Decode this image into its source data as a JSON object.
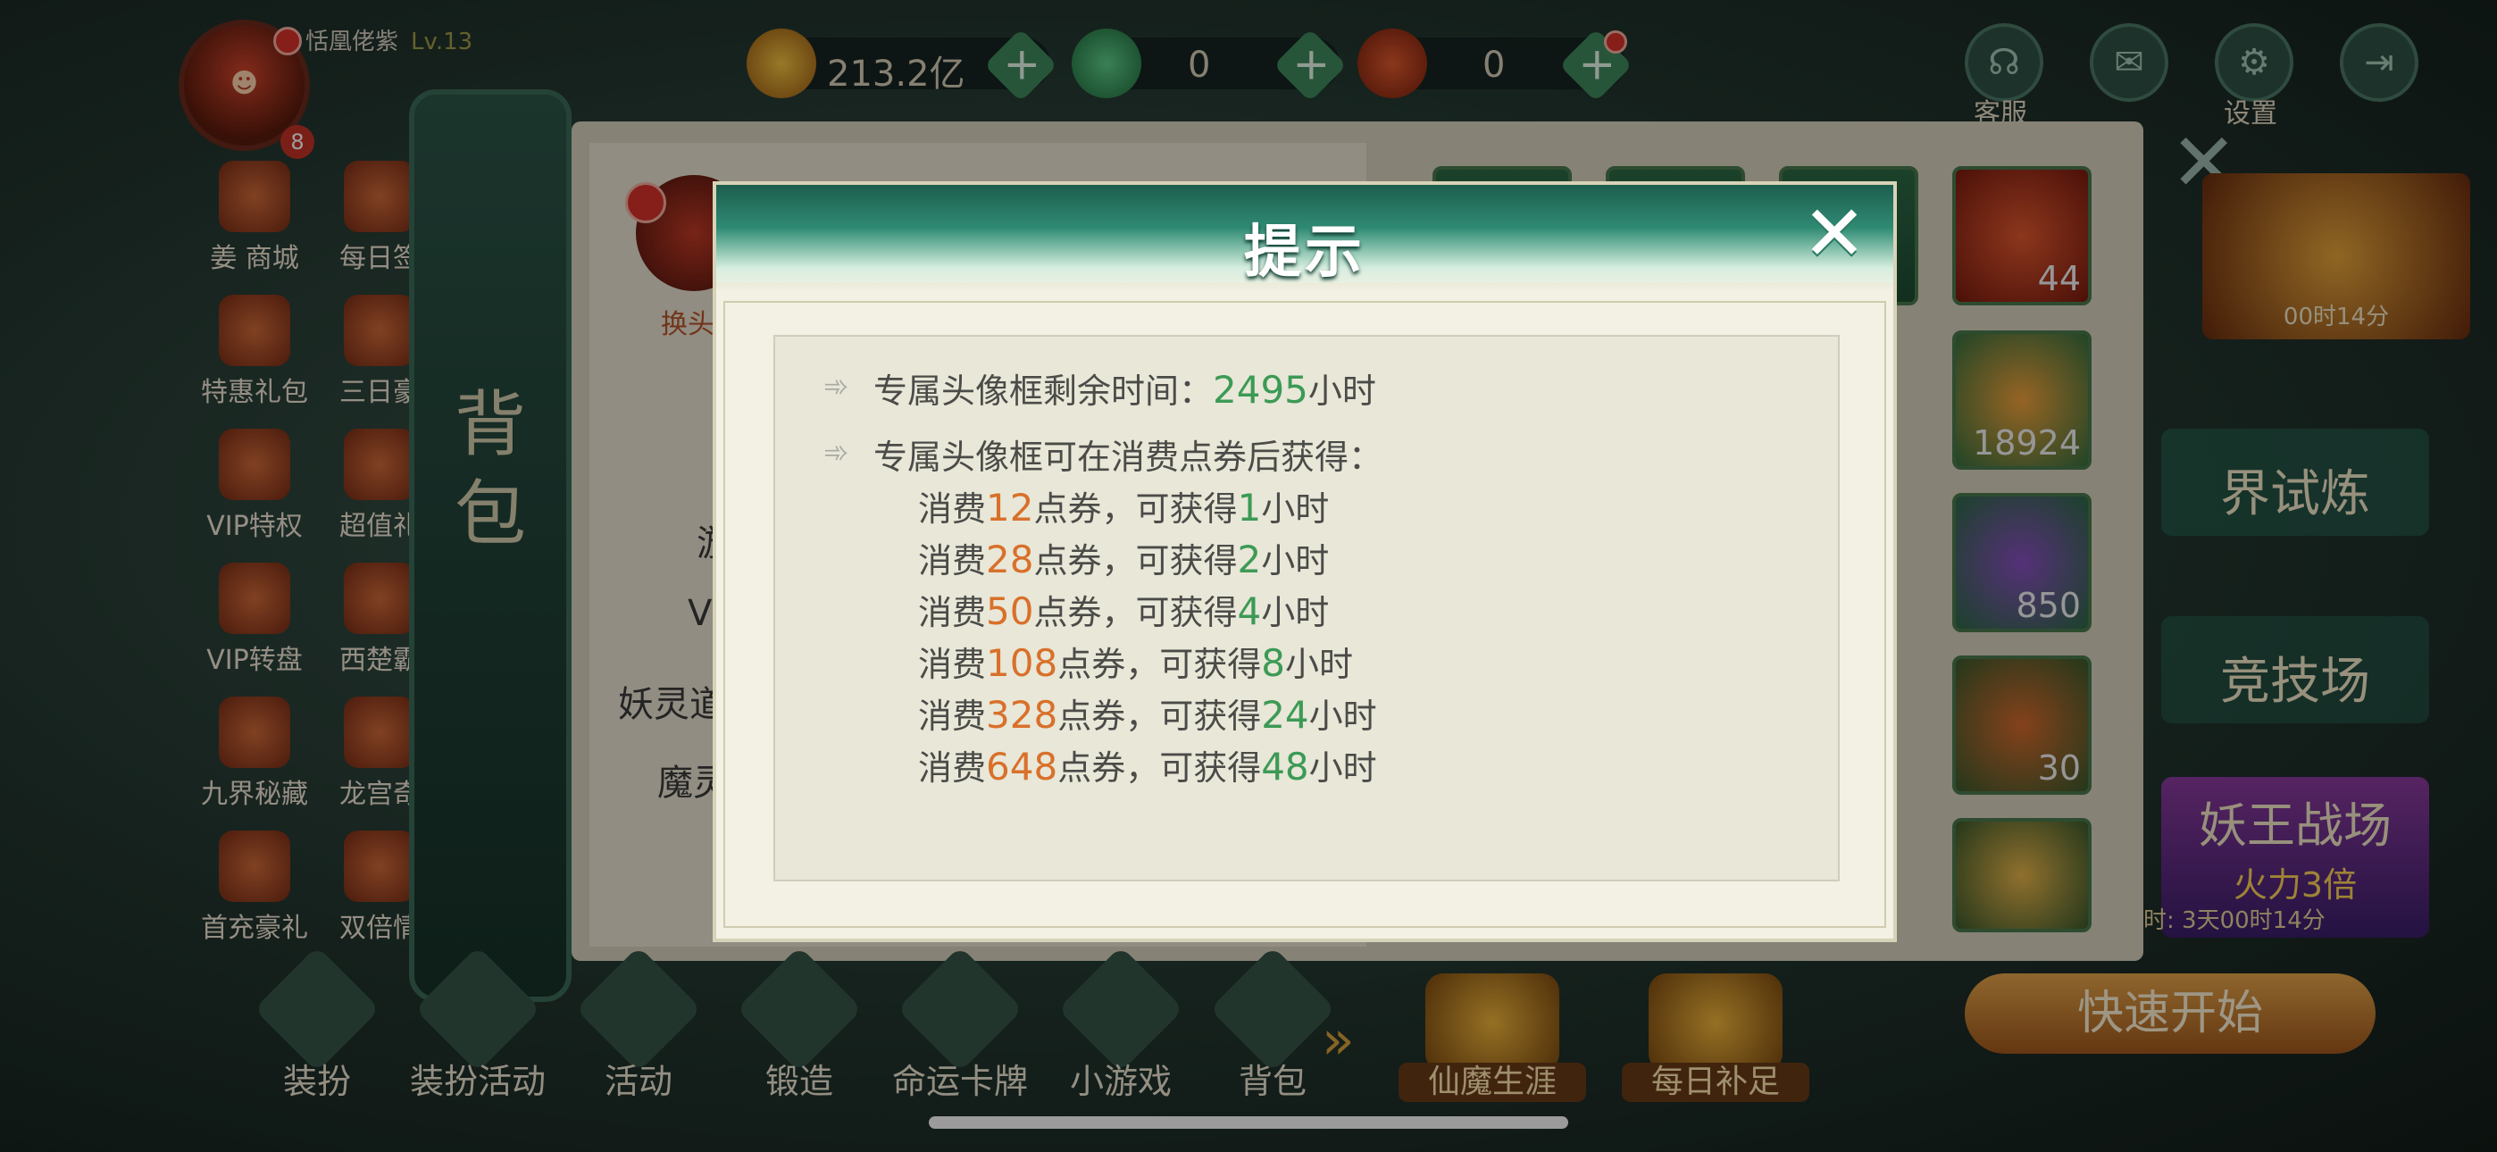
{
  "player": {
    "name": "恬凰佬紫",
    "level": "Lv.13",
    "badge_count": "8"
  },
  "currencies": [
    {
      "icon": "gold-coin-icon",
      "value": "213.2亿"
    },
    {
      "icon": "jade-icon",
      "value": "0"
    },
    {
      "icon": "red-ticket-icon",
      "value": "0"
    }
  ],
  "top_buttons": [
    {
      "icon": "customer-service-icon",
      "label": "客服"
    },
    {
      "icon": "scroll-icon",
      "label": ""
    },
    {
      "icon": "settings-gear-icon",
      "label": "设置"
    },
    {
      "icon": "exit-icon",
      "label": ""
    }
  ],
  "side_menu": [
    {
      "label": "姜 商城"
    },
    {
      "label": "每日签"
    },
    {
      "label": "特惠礼包"
    },
    {
      "label": "三日豪"
    },
    {
      "label": "VIP特权"
    },
    {
      "label": "超值礼"
    },
    {
      "label": "VIP转盘"
    },
    {
      "label": "西楚霸"
    },
    {
      "label": "九界秘藏"
    },
    {
      "label": "龙宫奇"
    },
    {
      "label": "首充豪礼"
    },
    {
      "label": "双倍情"
    }
  ],
  "bag_tab": {
    "label": "背包"
  },
  "bag_panel": {
    "swap_label": "换头",
    "left_labels": [
      "游",
      "V",
      "妖灵道",
      "魔灵"
    ],
    "item_counts": [
      "44",
      "18924",
      "850",
      "30",
      ""
    ]
  },
  "right_events": {
    "timer_top": "00时14分",
    "trial": "界试炼",
    "arena": "竞技场",
    "demon_king": "妖王战场",
    "firepower": "火力3倍",
    "timer_bottom": "时: 3天00时14分",
    "quick_start": "快速开始"
  },
  "bottom_nav": [
    {
      "label": "装扮"
    },
    {
      "label": "装扮活动"
    },
    {
      "label": "活动"
    },
    {
      "label": "锻造"
    },
    {
      "label": "命运卡牌"
    },
    {
      "label": "小游戏"
    },
    {
      "label": "背包"
    }
  ],
  "gold_buttons": [
    {
      "label": "仙魔生涯"
    },
    {
      "label": "每日补足"
    }
  ],
  "modal": {
    "title": "提示",
    "remaining_prefix": "专属头像框剩余时间：",
    "remaining_hours": "2495",
    "hours_unit": "小时",
    "obtain_heading": "专属头像框可在消费点券后获得：",
    "spend_word": "消费",
    "ticket_mid": "点券，可获得",
    "rewards": [
      {
        "cost": "12",
        "hours": "1"
      },
      {
        "cost": "28",
        "hours": "2"
      },
      {
        "cost": "50",
        "hours": "4"
      },
      {
        "cost": "108",
        "hours": "8"
      },
      {
        "cost": "328",
        "hours": "24"
      },
      {
        "cost": "648",
        "hours": "48"
      }
    ],
    "colors": {
      "green": "#3c9a55",
      "orange": "#d9702a",
      "header": "#2f8a73"
    }
  }
}
